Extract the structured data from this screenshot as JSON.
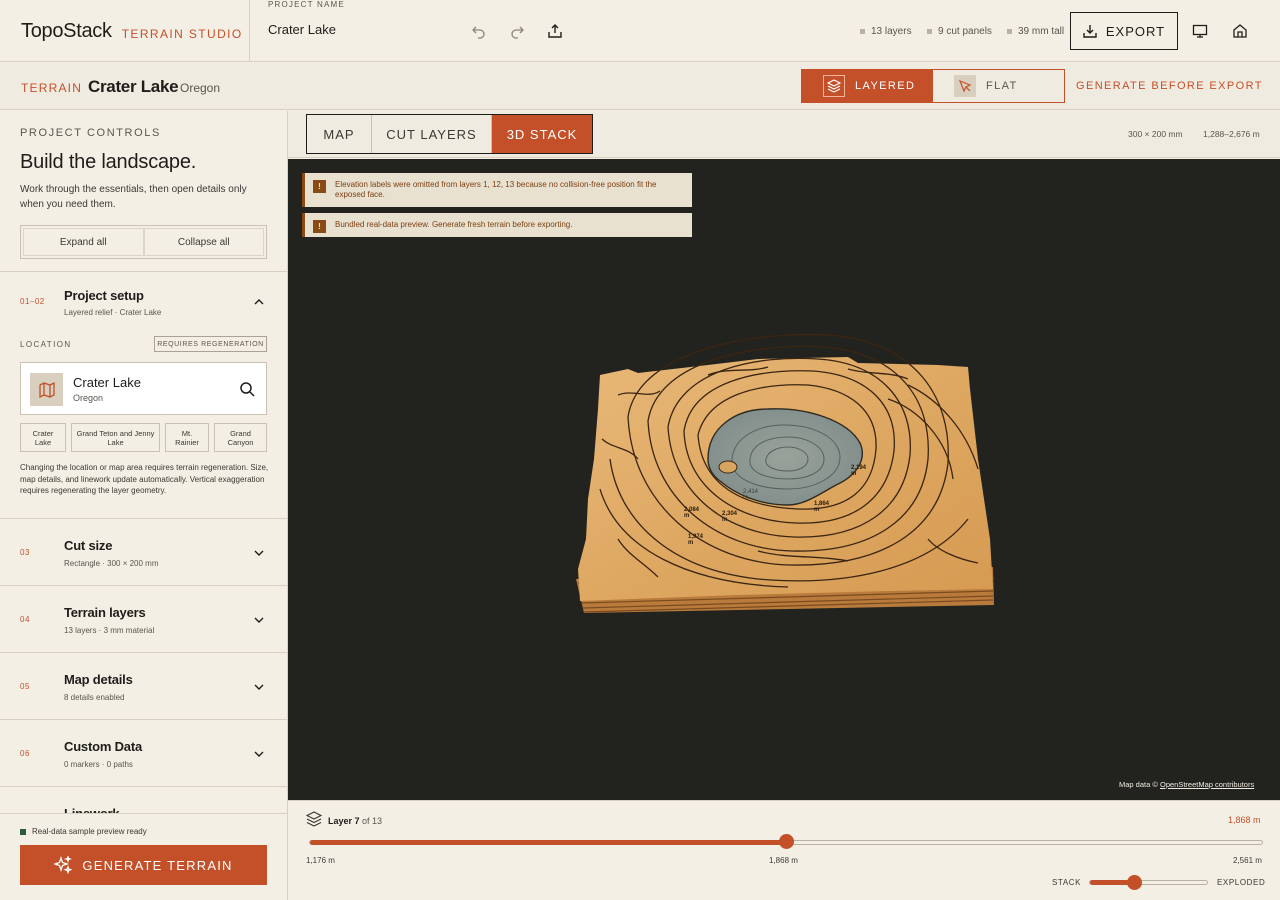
{
  "brand": {
    "name": "TopoStack",
    "subtitle": "TERRAIN STUDIO"
  },
  "project": {
    "label": "PROJECT NAME",
    "name": "Crater Lake"
  },
  "toolbar": {
    "icons": [
      "undo-icon",
      "redo-icon",
      "share-icon"
    ],
    "stats": [
      "13 layers",
      "9 cut panels",
      "39 mm tall"
    ],
    "export_label": "EXPORT"
  },
  "subheader": {
    "kicker": "TERRAIN",
    "title": "Crater Lake",
    "state": "Oregon",
    "modes": [
      {
        "label": "LAYERED",
        "active": true
      },
      {
        "label": "FLAT",
        "active": false
      }
    ],
    "generate_before_export": "GENERATE BEFORE EXPORT"
  },
  "sidebar": {
    "kicker": "PROJECT CONTROLS",
    "heading": "Build the landscape.",
    "intro": "Work through the essentials, then open details only when you need them.",
    "expand_all": "Expand all",
    "collapse_all": "Collapse all",
    "sections": [
      {
        "num": "01–02",
        "title": "Project setup",
        "meta": "Layered relief · Crater Lake",
        "expanded": true
      },
      {
        "num": "03",
        "title": "Cut size",
        "meta": "Rectangle · 300 × 200 mm"
      },
      {
        "num": "04",
        "title": "Terrain layers",
        "meta": "13 layers · 3 mm material"
      },
      {
        "num": "05",
        "title": "Map details",
        "meta": "8 details enabled"
      },
      {
        "num": "06",
        "title": "Custom Data",
        "meta": "0 markers · 0 paths"
      },
      {
        "num": "",
        "title": "Linework",
        "meta": ""
      }
    ],
    "location": {
      "label": "LOCATION",
      "badge": "REQUIRES REGENERATION",
      "name": "Crater Lake",
      "state": "Oregon",
      "presets": [
        "Crater Lake",
        "Grand Teton and Jenny Lake",
        "Mt. Rainier",
        "Grand Canyon"
      ],
      "note": "Changing the location or map area requires terrain regeneration. Size, map details, and linework update automatically. Vertical exaggeration requires regenerating the layer geometry."
    },
    "status": "Real-data sample preview ready",
    "generate_label": "GENERATE TERRAIN"
  },
  "viewer": {
    "tabs": [
      {
        "label": "MAP"
      },
      {
        "label": "CUT LAYERS"
      },
      {
        "label": "3D STACK",
        "active": true
      }
    ],
    "dimensions": "300 × 200 mm",
    "elevation_range": "1,288–2,676 m",
    "warnings": [
      "Elevation labels were omitted from layers 1, 12, 13 because no collision-free position fit the exposed face.",
      "Bundled real-data preview. Generate fresh terrain before exporting."
    ],
    "warning_icon": "!",
    "attribution_prefix": "Map data ©",
    "attribution_link": "OpenStreetMap contributors",
    "contour_labels": [
      "2,194 m",
      "2,084 m",
      "2,304 m",
      "2,414 m",
      "1,974 m",
      "1,864 m"
    ]
  },
  "layer_panel": {
    "layer": "Layer 7",
    "of": "of 13",
    "value": "1,868 m",
    "min": "1,176 m",
    "mid": "1,868 m",
    "max": "2,561 m",
    "level": 0.5,
    "stack_label": "STACK",
    "exploded_label": "EXPLODED",
    "explode_level": 0.38
  },
  "colors": {
    "accent": "#c4502a",
    "viewport": "#22231f",
    "background": "#f3efe5"
  }
}
